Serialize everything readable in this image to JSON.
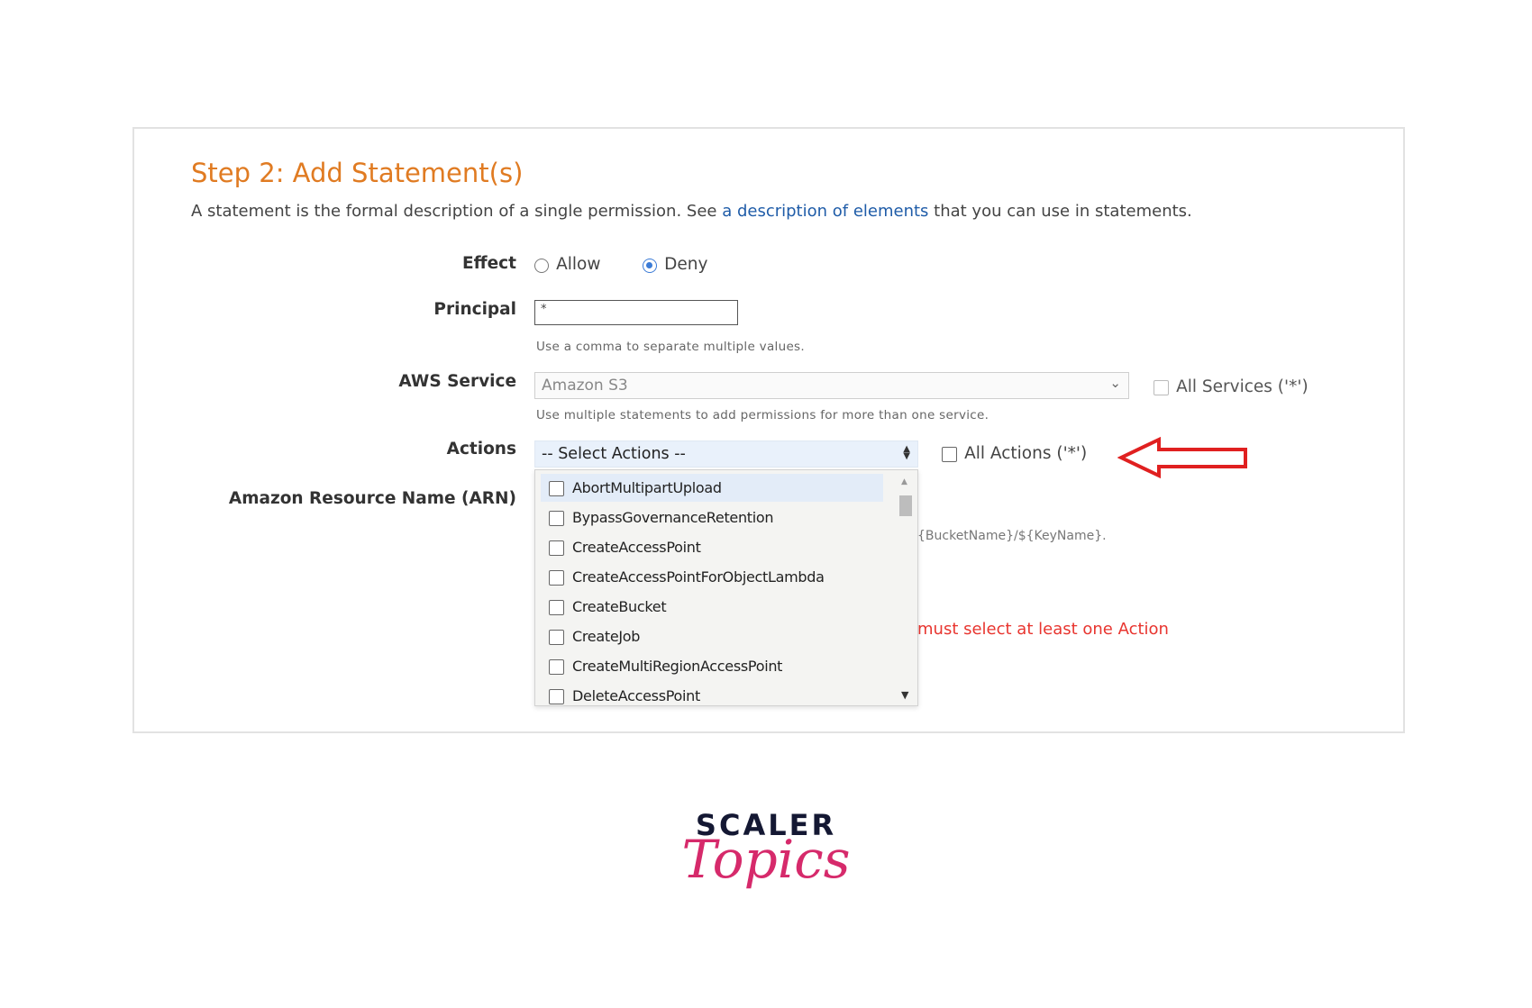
{
  "heading": {
    "title": "Step 2: Add Statement(s)",
    "description_pre": "A statement is the formal description of a single permission. See ",
    "description_link": "a description of elements",
    "description_post": " that you can use in statements."
  },
  "effect": {
    "label": "Effect",
    "options": [
      "Allow",
      "Deny"
    ],
    "selected": "Deny"
  },
  "principal": {
    "label": "Principal",
    "value": "*",
    "hint": "Use a comma to separate multiple values."
  },
  "aws_service": {
    "label": "AWS Service",
    "selected": "Amazon S3",
    "hint": "Use multiple statements to add permissions for more than one service.",
    "all_label": "All Services ('*')"
  },
  "actions": {
    "label": "Actions",
    "placeholder": "-- Select Actions --",
    "all_label": "All Actions ('*')",
    "items": [
      "AbortMultipartUpload",
      "BypassGovernanceRetention",
      "CreateAccessPoint",
      "CreateAccessPointForObjectLambda",
      "CreateBucket",
      "CreateJob",
      "CreateMultiRegionAccessPoint",
      "DeleteAccessPoint"
    ]
  },
  "arn": {
    "label": "Amazon Resource Name (ARN)",
    "hint_partial": "{BucketName}/${KeyName}."
  },
  "error": {
    "text": "must select at least one Action"
  },
  "logo": {
    "top": "SCALER",
    "bottom": "Topics"
  },
  "colors": {
    "title": "#e07b22",
    "link": "#1f5ca8",
    "error": "#e8352f",
    "arrow": "#e02020",
    "logo_pink": "#d62a6b",
    "logo_navy": "#141833"
  }
}
